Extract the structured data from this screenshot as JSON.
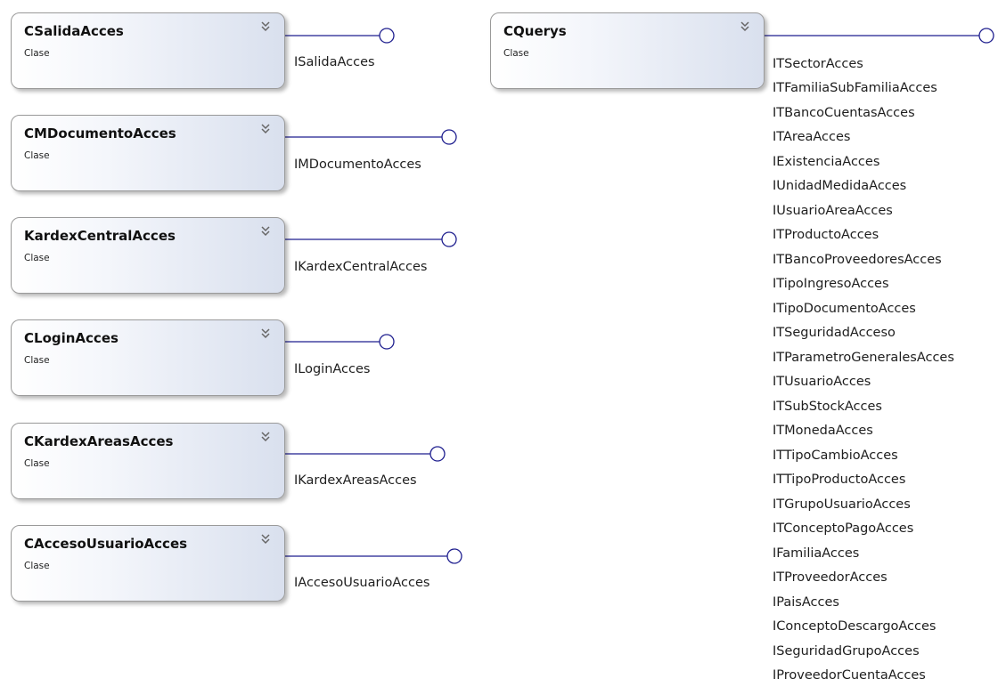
{
  "classes": [
    {
      "name": "CSalidaAcces",
      "type": "Clase",
      "interface": "ISalidaAcces"
    },
    {
      "name": "CMDocumentoAcces",
      "type": "Clase",
      "interface": "IMDocumentoAcces"
    },
    {
      "name": "KardexCentralAcces",
      "type": "Clase",
      "interface": "IKardexCentralAcces"
    },
    {
      "name": "CLoginAcces",
      "type": "Clase",
      "interface": "ILoginAcces"
    },
    {
      "name": "CKardexAreasAcces",
      "type": "Clase",
      "interface": "IKardexAreasAcces"
    },
    {
      "name": "CAccesoUsuarioAcces",
      "type": "Clase",
      "interface": "IAccesoUsuarioAcces"
    }
  ],
  "querys": {
    "name": "CQuerys",
    "type": "Clase",
    "interfaces": [
      "ITSectorAcces",
      "ITFamiliaSubFamiliaAcces",
      "ITBancoCuentasAcces",
      "ITAreaAcces",
      "IExistenciaAcces",
      "IUnidadMedidaAcces",
      "IUsuarioAreaAcces",
      "ITProductoAcces",
      "ITBancoProveedoresAcces",
      "ITipoIngresoAcces",
      "ITipoDocumentoAcces",
      "ITSeguridadAcceso",
      "ITParametroGeneralesAcces",
      "ITUsuarioAcces",
      "ITSubStockAcces",
      "ITMonedaAcces",
      "ITTipoCambioAcces",
      "ITTipoProductoAcces",
      "ITGrupoUsuarioAcces",
      "ITConceptoPagoAcces",
      "IFamiliaAcces",
      "ITProveedorAcces",
      "IPaisAcces",
      "IConceptoDescargoAcces",
      "ISeguridadGrupoAcces",
      "IProveedorCuentaAcces"
    ]
  },
  "colors": {
    "connector": "#1f1f8f",
    "box_border": "#9a9a9a",
    "box_gradient_end": "#d9e0ee"
  },
  "icons": {
    "collapse": "double-chevron-up-icon",
    "interface": "lollipop-interface-icon"
  }
}
